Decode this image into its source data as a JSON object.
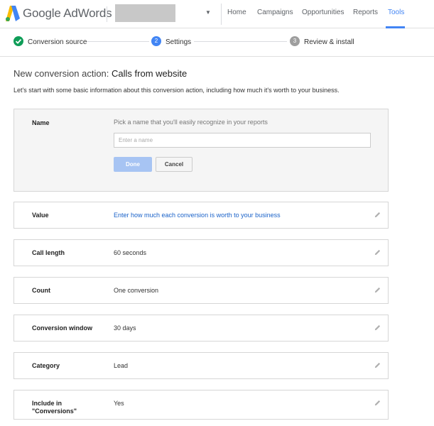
{
  "header": {
    "app_name": "Google AdWords",
    "nav": [
      {
        "label": "Home",
        "active": false
      },
      {
        "label": "Campaigns",
        "active": false
      },
      {
        "label": "Opportunities",
        "active": false
      },
      {
        "label": "Reports",
        "active": false
      },
      {
        "label": "Tools",
        "active": true
      }
    ]
  },
  "stepper": {
    "steps": [
      {
        "label": "Conversion source",
        "state": "done",
        "marker": ""
      },
      {
        "label": "Settings",
        "state": "current",
        "marker": "2"
      },
      {
        "label": "Review & install",
        "state": "upcoming",
        "marker": "3"
      }
    ]
  },
  "page": {
    "title_prefix": "New conversion action:",
    "title_name": "Calls from website",
    "intro": "Let's start with some basic information about this conversion action, including how much it's worth to your business."
  },
  "name_section": {
    "label": "Name",
    "hint": "Pick a name that you'll easily recognize in your reports",
    "input_value": "",
    "input_placeholder": "Enter a name",
    "done_label": "Done",
    "cancel_label": "Cancel"
  },
  "rows": [
    {
      "label": "Value",
      "value": "Enter how much each conversion is worth to your business",
      "is_link": true
    },
    {
      "label": "Call length",
      "value": "60 seconds",
      "is_link": false
    },
    {
      "label": "Count",
      "value": "One conversion",
      "is_link": false
    },
    {
      "label": "Conversion window",
      "value": "30 days",
      "is_link": false
    },
    {
      "label": "Category",
      "value": "Lead",
      "is_link": false
    },
    {
      "label": "Include in \"Conversions\"",
      "value": "Yes",
      "is_link": false
    }
  ],
  "colors": {
    "accent": "#4285f4",
    "done_green": "#0f9d58",
    "upcoming_gray": "#9e9e9e",
    "link_blue": "#1a62c9"
  },
  "icons": {
    "logo": "adwords-logo-icon",
    "caret": "caret-down-icon",
    "done_step": "check-circle-icon",
    "edit": "pencil-icon"
  }
}
